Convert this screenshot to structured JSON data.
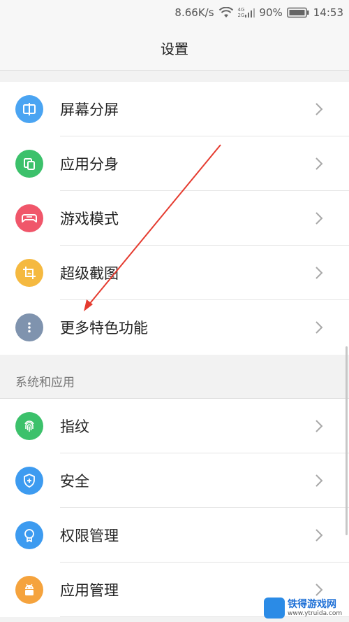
{
  "status_bar": {
    "speed": "8.66K/s",
    "net_top": "4G",
    "net_bottom": "2G",
    "battery": "90%",
    "time": "14:53"
  },
  "header": {
    "title": "设置"
  },
  "section1": {
    "items": [
      {
        "label": "屏幕分屏",
        "icon": "split-screen-icon",
        "color": "#4aa4f2"
      },
      {
        "label": "应用分身",
        "icon": "app-clone-icon",
        "color": "#3cc16b"
      },
      {
        "label": "游戏模式",
        "icon": "gamepad-icon",
        "color": "#f0566a"
      },
      {
        "label": "超级截图",
        "icon": "crop-screenshot-icon",
        "color": "#f5b940"
      },
      {
        "label": "更多特色功能",
        "icon": "more-dots-icon",
        "color": "#7f93ae"
      }
    ]
  },
  "section2": {
    "header": "系统和应用",
    "items": [
      {
        "label": "指纹",
        "icon": "fingerprint-icon",
        "color": "#3cc16b"
      },
      {
        "label": "安全",
        "icon": "security-shield-icon",
        "color": "#3d9bf0"
      },
      {
        "label": "权限管理",
        "icon": "permission-badge-icon",
        "color": "#3d9bf0"
      },
      {
        "label": "应用管理",
        "icon": "android-robot-icon",
        "color": "#f5a33d"
      }
    ]
  },
  "annotation": {
    "color": "#e53b2f"
  },
  "watermark": {
    "name": "铁得游戏网",
    "url": "www.ytruida.com"
  }
}
